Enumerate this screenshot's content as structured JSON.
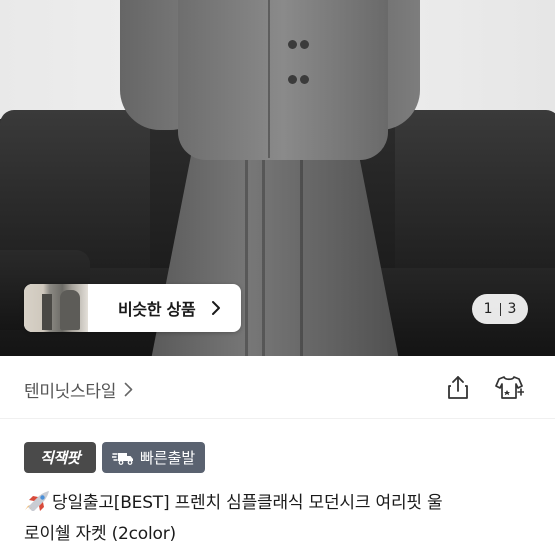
{
  "product_image": {
    "similar_button_label": "비슷한 상품",
    "counter_current": "1",
    "counter_total": "3"
  },
  "shop": {
    "name": "텐미닛스타일"
  },
  "badges": {
    "direct": "직잭팟",
    "fast_shipping": "빠른출발"
  },
  "title": {
    "line1": "당일출고[BEST] 프렌치 심플클래식 모던시크 여리핏 울",
    "line2": "로이쉘 자켓 (2color)"
  },
  "icons": [
    "share-icon",
    "closet-icon",
    "chevron-right-icon",
    "truck-icon",
    "rocket-icon"
  ]
}
